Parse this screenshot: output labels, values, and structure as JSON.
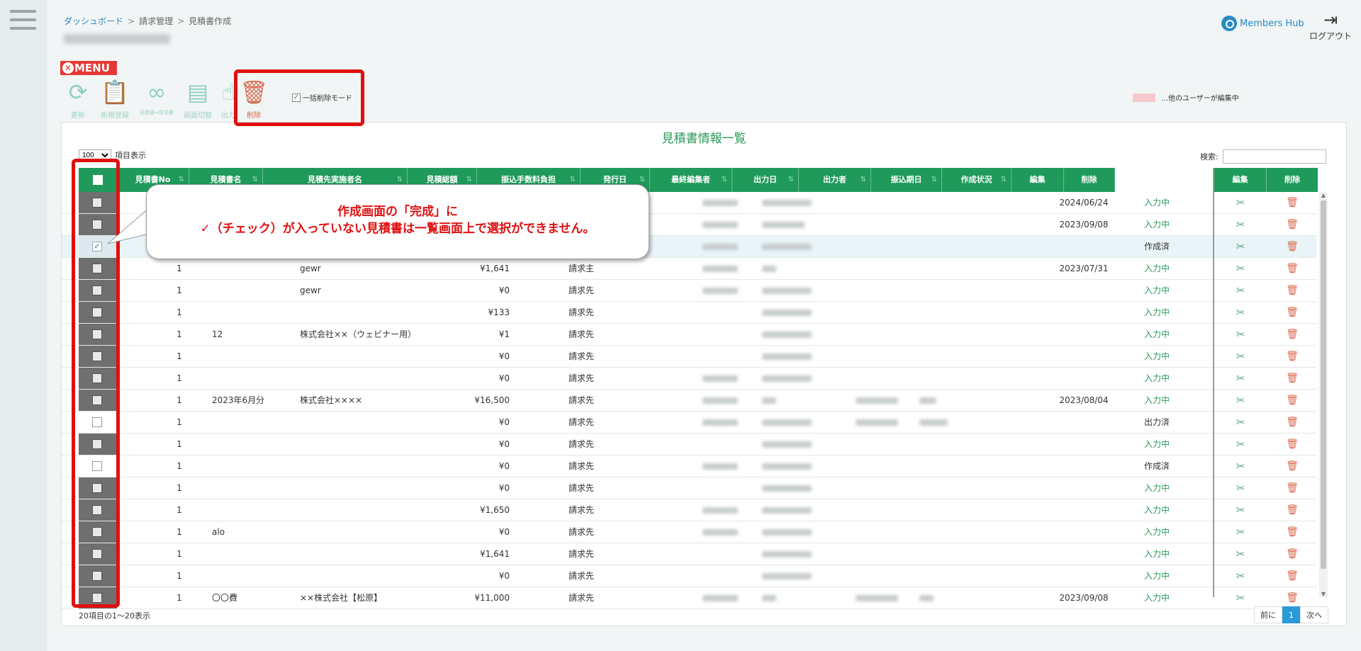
{
  "breadcrumb": {
    "item1": "ダッシュボード",
    "item2": "請求管理",
    "item3": "見積書作成",
    "sep": ">"
  },
  "brand": "Members Hub",
  "logout_label": "ログアウト",
  "menu_label": "MENU",
  "toolbar": {
    "refresh": "更新",
    "new": "新規登録",
    "convert": "見積書⇔請求書",
    "switch_view": "画面切替",
    "output": "出力",
    "delete": "削除"
  },
  "bulk_delete_label": "一括削除モード",
  "legend_label": "…他のユーザーが編集中",
  "panel_title": "見積書情報一覧",
  "page_size": "100",
  "page_size_suffix": "項目表示",
  "search_label": "検索:",
  "headers": {
    "no": "見積書No",
    "name": "見積書名",
    "customer": "見積先実施者名",
    "amount": "見積総額",
    "fee": "振込手数料負担",
    "issue": "発行日",
    "editor": "最終編集者",
    "out_date": "出力日",
    "outputter": "出力者",
    "pay_date": "振込期日",
    "state": "作成状況",
    "edit": "編集",
    "del": "削除",
    "edit2": "編集",
    "del2": "削除"
  },
  "callout": {
    "line1": "作成画面の「完成」に",
    "line2": "✓（チェック）が入っていない見積書は一覧画面上で選択ができません。"
  },
  "rows": [
    {
      "no": "",
      "name": "",
      "customer": "",
      "amount": "",
      "fee": "",
      "issue_date": "2024/06/24",
      "status": "入力中"
    },
    {
      "no": "",
      "name": "",
      "customer": "",
      "amount": "",
      "fee": "",
      "issue_date": "2023/09/08",
      "status": "入力中"
    },
    {
      "no": "",
      "name": "",
      "customer": "",
      "amount": "",
      "fee": "",
      "issue_date": "",
      "status": "作成済"
    },
    {
      "no": "1",
      "name": "",
      "customer": "gewr",
      "amount": "¥1,641",
      "fee": "請求主",
      "issue_date": "2023/07/31",
      "status": "入力中"
    },
    {
      "no": "1",
      "name": "",
      "customer": "gewr",
      "amount": "¥0",
      "fee": "請求先",
      "issue_date": "",
      "status": "入力中"
    },
    {
      "no": "1",
      "name": "",
      "customer": "",
      "amount": "¥133",
      "fee": "請求先",
      "issue_date": "",
      "status": "入力中"
    },
    {
      "no": "1",
      "name": "12",
      "customer": "株式会社××（ウェビナー用）",
      "amount": "¥1",
      "fee": "請求先",
      "issue_date": "",
      "status": "入力中"
    },
    {
      "no": "1",
      "name": "",
      "customer": "",
      "amount": "¥0",
      "fee": "請求先",
      "issue_date": "",
      "status": "入力中"
    },
    {
      "no": "1",
      "name": "",
      "customer": "",
      "amount": "¥0",
      "fee": "請求先",
      "issue_date": "",
      "status": "入力中"
    },
    {
      "no": "1",
      "name": "2023年6月分",
      "customer": "株式会社××××",
      "amount": "¥16,500",
      "fee": "請求先",
      "issue_date": "2023/08/04",
      "status": "入力中"
    },
    {
      "no": "1",
      "name": "",
      "customer": "",
      "amount": "¥0",
      "fee": "請求先",
      "issue_date": "",
      "status": "出力済"
    },
    {
      "no": "1",
      "name": "",
      "customer": "",
      "amount": "¥0",
      "fee": "請求先",
      "issue_date": "",
      "status": "入力中"
    },
    {
      "no": "1",
      "name": "",
      "customer": "",
      "amount": "¥0",
      "fee": "請求先",
      "issue_date": "",
      "status": "作成済"
    },
    {
      "no": "1",
      "name": "",
      "customer": "",
      "amount": "¥0",
      "fee": "請求先",
      "issue_date": "",
      "status": "入力中"
    },
    {
      "no": "1",
      "name": "",
      "customer": "",
      "amount": "¥1,650",
      "fee": "請求先",
      "issue_date": "",
      "status": "入力中"
    },
    {
      "no": "1",
      "name": "alo",
      "customer": "",
      "amount": "¥0",
      "fee": "請求先",
      "issue_date": "",
      "status": "入力中"
    },
    {
      "no": "1",
      "name": "",
      "customer": "",
      "amount": "¥1,641",
      "fee": "請求先",
      "issue_date": "",
      "status": "入力中"
    },
    {
      "no": "1",
      "name": "",
      "customer": "",
      "amount": "¥0",
      "fee": "請求先",
      "issue_date": "",
      "status": "入力中"
    },
    {
      "no": "1",
      "name": "〇〇費",
      "customer": "××株式会社【松原】",
      "amount": "¥11,000",
      "fee": "請求先",
      "issue_date": "2023/09/08",
      "status": "入力中"
    }
  ],
  "footer_info": "20項目の1～20表示",
  "pager": {
    "prev": "前に",
    "current": "1",
    "next": "次へ"
  },
  "colors": {
    "accent": "#1f9a5a",
    "highlight": "#e01010",
    "link": "#2a8ac7"
  }
}
